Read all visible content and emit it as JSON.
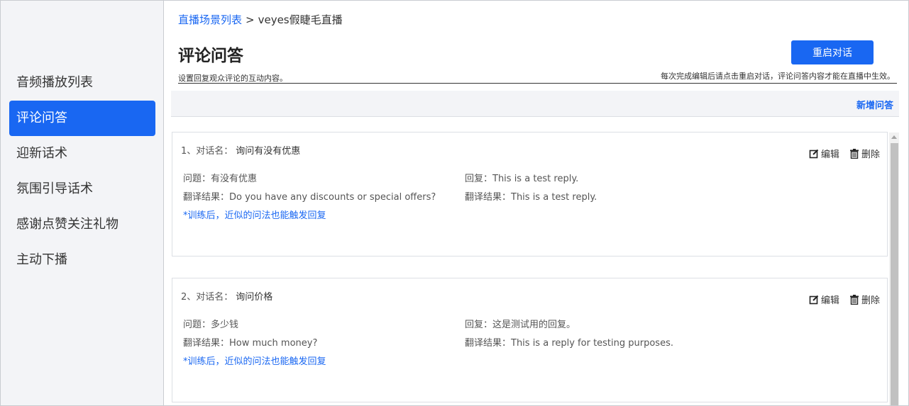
{
  "sidebar": {
    "items": [
      {
        "label": "音频播放列表"
      },
      {
        "label": "评论问答"
      },
      {
        "label": "迎新话术"
      },
      {
        "label": "氛围引导话术"
      },
      {
        "label": "感谢点赞关注礼物"
      },
      {
        "label": "主动下播"
      }
    ],
    "active_index": 1
  },
  "breadcrumb": {
    "root": "直播场景列表",
    "separator": ">",
    "current": "veyes假睫毛直播"
  },
  "header": {
    "title": "评论问答",
    "restart_button": "重启对话",
    "subtitle": "设置回复观众评论的互动内容。",
    "hint": "每次完成编辑后请点击重启对话，评论问答内容才能在直播中生效。"
  },
  "toolbar": {
    "add_label": "新增问答"
  },
  "qa_list": [
    {
      "index_label": "1、对话名：",
      "name": "询问有没有优惠",
      "edit_label": "编辑",
      "delete_label": "删除",
      "question": "问题：有没有优惠",
      "question_translation": "翻译结果：Do you have any discounts or special offers?",
      "reply": "回复：This is a test reply.",
      "reply_translation": "翻译结果：This is a test reply.",
      "train_note": "*训练后，近似的问法也能触发回复"
    },
    {
      "index_label": "2、对话名：",
      "name": "询问价格",
      "edit_label": "编辑",
      "delete_label": "删除",
      "question": "问题：多少钱",
      "question_translation": "翻译结果：How much money?",
      "reply": "回复：这是测试用的回复。",
      "reply_translation": "翻译结果：This is a reply for testing purposes.",
      "train_note": "*训练后，近似的问法也能触发回复"
    }
  ],
  "colors": {
    "accent": "#1967f2",
    "sidebar_bg": "#f3f4f7",
    "border": "#dcdfe4"
  },
  "icons": [
    "edit-icon",
    "trash-icon",
    "scroll-up-arrow"
  ]
}
